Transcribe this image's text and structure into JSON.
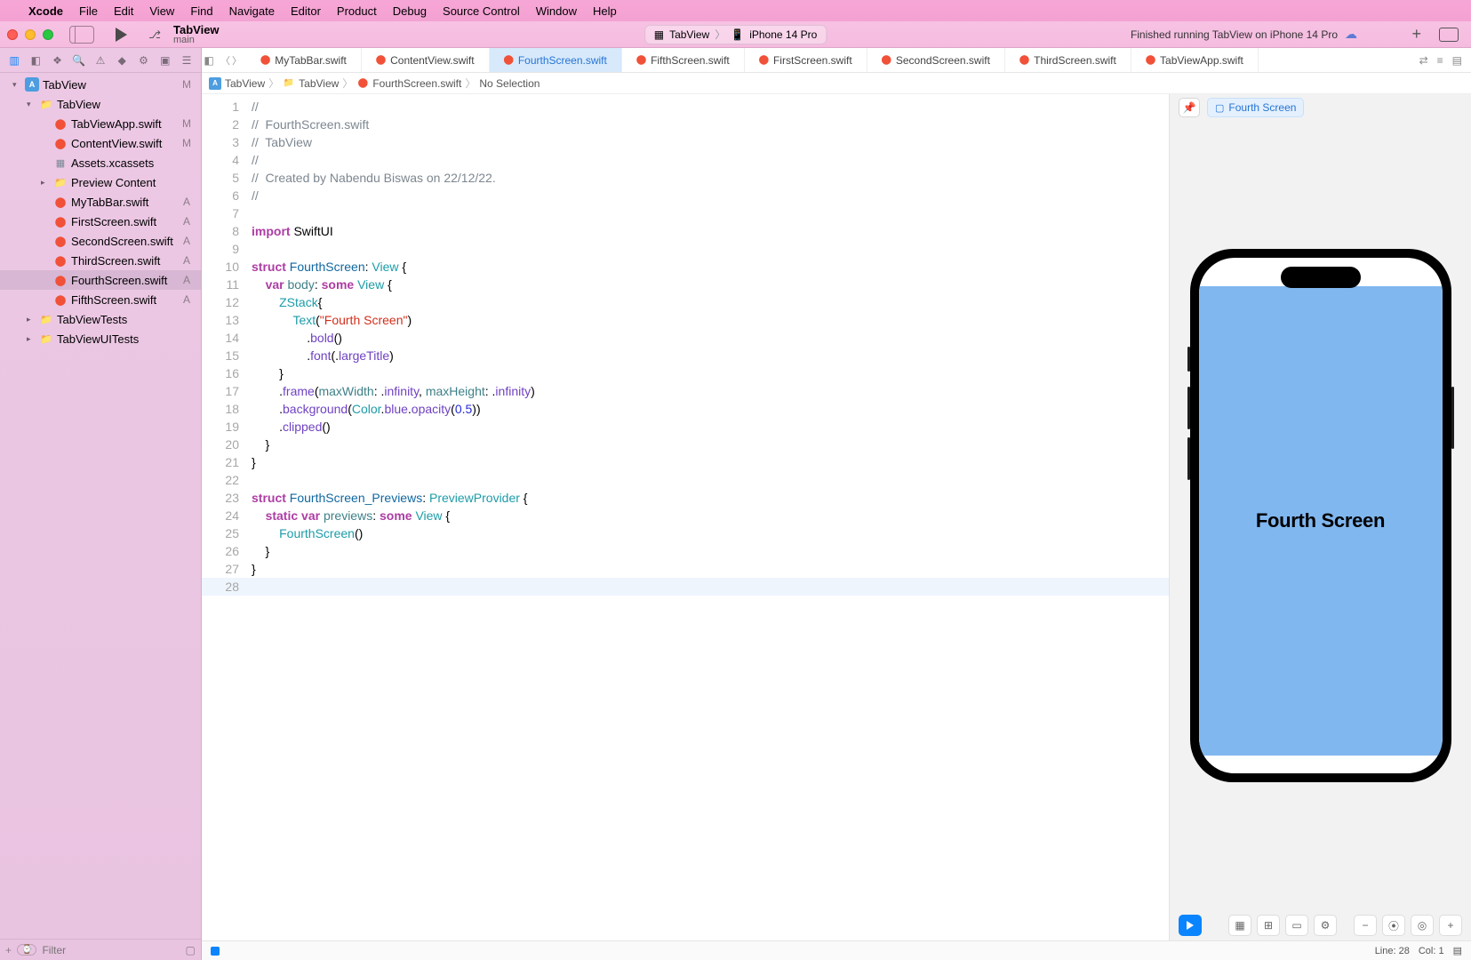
{
  "menu": {
    "apple": "",
    "appname": "Xcode",
    "items": [
      "File",
      "Edit",
      "View",
      "Find",
      "Navigate",
      "Editor",
      "Product",
      "Debug",
      "Source Control",
      "Window",
      "Help"
    ]
  },
  "toolbar": {
    "project": "TabView",
    "branch": "main",
    "scheme_target": "TabView",
    "scheme_device": "iPhone 14 Pro",
    "status": "Finished running TabView on iPhone 14 Pro"
  },
  "navigator": {
    "filter_placeholder": "Filter",
    "tree": [
      {
        "depth": 0,
        "kind": "proj",
        "disc": "▾",
        "name": "TabView",
        "badge": "M"
      },
      {
        "depth": 1,
        "kind": "folder",
        "disc": "▾",
        "name": "TabView",
        "badge": ""
      },
      {
        "depth": 2,
        "kind": "swift",
        "disc": "",
        "name": "TabViewApp.swift",
        "badge": "M"
      },
      {
        "depth": 2,
        "kind": "swift",
        "disc": "",
        "name": "ContentView.swift",
        "badge": "M"
      },
      {
        "depth": 2,
        "kind": "assets",
        "disc": "",
        "name": "Assets.xcassets",
        "badge": ""
      },
      {
        "depth": 2,
        "kind": "folder",
        "disc": "▸",
        "name": "Preview Content",
        "badge": ""
      },
      {
        "depth": 2,
        "kind": "swift",
        "disc": "",
        "name": "MyTabBar.swift",
        "badge": "A"
      },
      {
        "depth": 2,
        "kind": "swift",
        "disc": "",
        "name": "FirstScreen.swift",
        "badge": "A"
      },
      {
        "depth": 2,
        "kind": "swift",
        "disc": "",
        "name": "SecondScreen.swift",
        "badge": "A"
      },
      {
        "depth": 2,
        "kind": "swift",
        "disc": "",
        "name": "ThirdScreen.swift",
        "badge": "A"
      },
      {
        "depth": 2,
        "kind": "swift",
        "disc": "",
        "name": "FourthScreen.swift",
        "badge": "A",
        "selected": true
      },
      {
        "depth": 2,
        "kind": "swift",
        "disc": "",
        "name": "FifthScreen.swift",
        "badge": "A"
      },
      {
        "depth": 1,
        "kind": "folder",
        "disc": "▸",
        "name": "TabViewTests",
        "badge": ""
      },
      {
        "depth": 1,
        "kind": "folder",
        "disc": "▸",
        "name": "TabViewUITests",
        "badge": ""
      }
    ]
  },
  "tabs": [
    {
      "name": "MyTabBar.swift"
    },
    {
      "name": "ContentView.swift"
    },
    {
      "name": "FourthScreen.swift",
      "active": true
    },
    {
      "name": "FifthScreen.swift"
    },
    {
      "name": "FirstScreen.swift"
    },
    {
      "name": "SecondScreen.swift"
    },
    {
      "name": "ThirdScreen.swift"
    },
    {
      "name": "TabViewApp.swift"
    }
  ],
  "jumpbar": {
    "proj": "TabView",
    "folder": "TabView",
    "file": "FourthScreen.swift",
    "sel": "No Selection"
  },
  "code": [
    {
      "n": 1,
      "html": "<span class='c-comm'>//</span>"
    },
    {
      "n": 2,
      "html": "<span class='c-comm'>//  FourthScreen.swift</span>"
    },
    {
      "n": 3,
      "html": "<span class='c-comm'>//  TabView</span>"
    },
    {
      "n": 4,
      "html": "<span class='c-comm'>//</span>"
    },
    {
      "n": 5,
      "html": "<span class='c-comm'>//  Created by Nabendu Biswas on 22/12/22.</span>"
    },
    {
      "n": 6,
      "html": "<span class='c-comm'>//</span>"
    },
    {
      "n": 7,
      "html": ""
    },
    {
      "n": 8,
      "html": "<span class='c-kw'>import</span> SwiftUI"
    },
    {
      "n": 9,
      "html": ""
    },
    {
      "n": 10,
      "html": "<span class='c-kw'>struct</span> <span class='c-ident'>FourthScreen</span>: <span class='c-type2'>View</span> {"
    },
    {
      "n": 11,
      "html": "    <span class='c-kw'>var</span> <span class='c-attr'>body</span>: <span class='c-kw'>some</span> <span class='c-type2'>View</span> {"
    },
    {
      "n": 12,
      "html": "        <span class='c-type2'>ZStack</span>{"
    },
    {
      "n": 13,
      "html": "            <span class='c-type2'>Text</span>(<span class='c-str'>\"Fourth Screen\"</span>)"
    },
    {
      "n": 14,
      "html": "                .<span class='c-func'>bold</span>()"
    },
    {
      "n": 15,
      "html": "                .<span class='c-func'>font</span>(.<span class='c-func'>largeTitle</span>)"
    },
    {
      "n": 16,
      "html": "        }"
    },
    {
      "n": 17,
      "html": "        .<span class='c-func'>frame</span>(<span class='c-attr'>maxWidth</span>: .<span class='c-func'>infinity</span>, <span class='c-attr'>maxHeight</span>: .<span class='c-func'>infinity</span>)"
    },
    {
      "n": 18,
      "html": "        .<span class='c-func'>background</span>(<span class='c-type2'>Color</span>.<span class='c-func'>blue</span>.<span class='c-func'>opacity</span>(<span class='c-num'>0.5</span>))"
    },
    {
      "n": 19,
      "html": "        .<span class='c-func'>clipped</span>()"
    },
    {
      "n": 20,
      "html": "    }"
    },
    {
      "n": 21,
      "html": "}"
    },
    {
      "n": 22,
      "html": ""
    },
    {
      "n": 23,
      "html": "<span class='c-kw'>struct</span> <span class='c-ident'>FourthScreen_Previews</span>: <span class='c-type2'>PreviewProvider</span> {"
    },
    {
      "n": 24,
      "html": "    <span class='c-kw'>static</span> <span class='c-kw'>var</span> <span class='c-attr'>previews</span>: <span class='c-kw'>some</span> <span class='c-type2'>View</span> {"
    },
    {
      "n": 25,
      "html": "        <span class='c-type2'>FourthScreen</span>()"
    },
    {
      "n": 26,
      "html": "    }"
    },
    {
      "n": 27,
      "html": "}"
    },
    {
      "n": 28,
      "html": "",
      "cursor": true
    }
  ],
  "canvas": {
    "preview_name": "Fourth Screen",
    "screen_text": "Fourth Screen"
  },
  "status": {
    "line": "Line: 28",
    "col": "Col: 1"
  }
}
